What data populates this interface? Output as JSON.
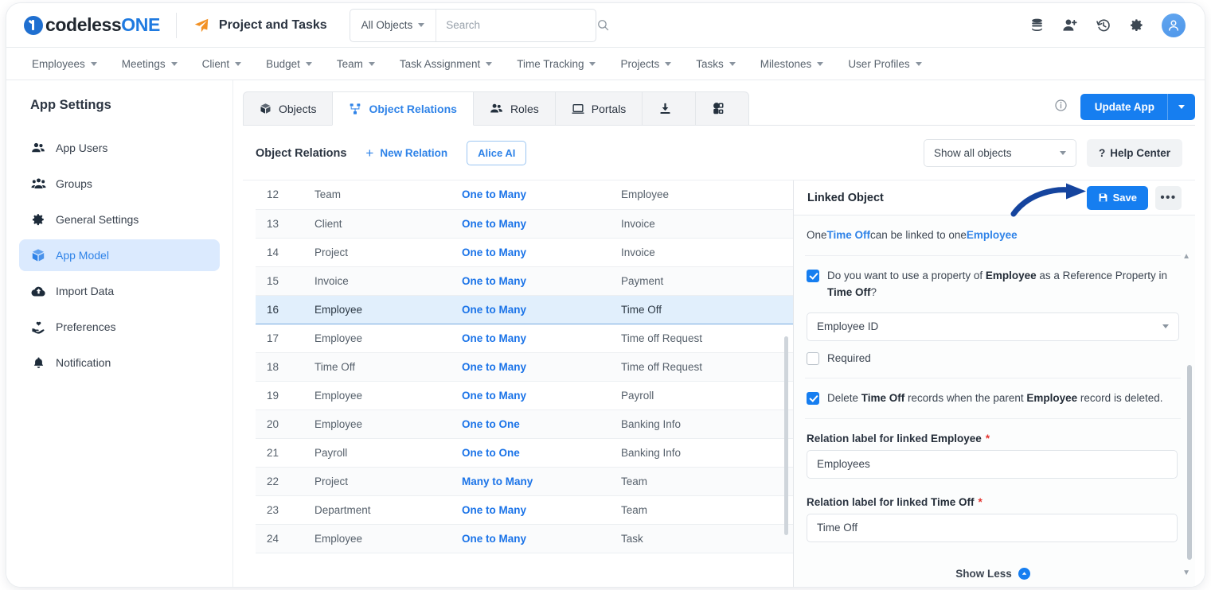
{
  "topbar": {
    "brand_codeless": "codeless",
    "brand_one": "ONE",
    "project_title": "Project and Tasks",
    "object_filter": "All Objects",
    "search_placeholder": "Search",
    "search_value": "",
    "icons": [
      "database-icon",
      "add-user-icon",
      "history-icon",
      "gear-icon",
      "avatar-icon"
    ]
  },
  "menubar": {
    "items": [
      {
        "label": "Employees"
      },
      {
        "label": "Meetings"
      },
      {
        "label": "Client"
      },
      {
        "label": "Budget"
      },
      {
        "label": "Team"
      },
      {
        "label": "Task Assignment"
      },
      {
        "label": "Time Tracking"
      },
      {
        "label": "Projects"
      },
      {
        "label": "Tasks"
      },
      {
        "label": "Milestones"
      },
      {
        "label": "User Profiles"
      }
    ]
  },
  "sidebar": {
    "title": "App Settings",
    "items": [
      {
        "label": "App Users",
        "icon": "users-icon",
        "active": false
      },
      {
        "label": "Groups",
        "icon": "group-icon",
        "active": false
      },
      {
        "label": "General Settings",
        "icon": "gear-icon",
        "active": false
      },
      {
        "label": "App Model",
        "icon": "cube-icon",
        "active": true
      },
      {
        "label": "Import Data",
        "icon": "cloud-upload-icon",
        "active": false
      },
      {
        "label": "Preferences",
        "icon": "hand-heart-icon",
        "active": false
      },
      {
        "label": "Notification",
        "icon": "bell-icon",
        "active": false
      }
    ]
  },
  "tabs": [
    {
      "label": "Objects",
      "icon": "cube-icon",
      "active": false
    },
    {
      "label": "Object Relations",
      "icon": "relations-icon",
      "active": true
    },
    {
      "label": "Roles",
      "icon": "users-icon",
      "active": false
    },
    {
      "label": "Portals",
      "icon": "portal-icon",
      "active": false
    },
    {
      "label": "",
      "icon": "download-icon",
      "active": false
    },
    {
      "label": "",
      "icon": "shapes-icon",
      "active": false
    }
  ],
  "header_actions": {
    "info_icon": "info-icon",
    "update_label": "Update App"
  },
  "toolbar": {
    "title": "Object Relations",
    "new_relation_label": "New Relation",
    "new_relation_plus": "+",
    "alice_label": "Alice AI",
    "show_objects_value": "Show all objects",
    "help_label": "Help Center",
    "help_mark": "?"
  },
  "table": {
    "rows": [
      {
        "id": "12",
        "from": "Team",
        "relation": "One to Many",
        "to": "Employee",
        "selected": false
      },
      {
        "id": "13",
        "from": "Client",
        "relation": "One to Many",
        "to": "Invoice",
        "selected": false
      },
      {
        "id": "14",
        "from": "Project",
        "relation": "One to Many",
        "to": "Invoice",
        "selected": false
      },
      {
        "id": "15",
        "from": "Invoice",
        "relation": "One to Many",
        "to": "Payment",
        "selected": false
      },
      {
        "id": "16",
        "from": "Employee",
        "relation": "One to Many",
        "to": "Time Off",
        "selected": true
      },
      {
        "id": "17",
        "from": "Employee",
        "relation": "One to Many",
        "to": "Time off Request",
        "selected": false
      },
      {
        "id": "18",
        "from": "Time Off",
        "relation": "One to Many",
        "to": "Time off Request",
        "selected": false
      },
      {
        "id": "19",
        "from": "Employee",
        "relation": "One to Many",
        "to": "Payroll",
        "selected": false
      },
      {
        "id": "20",
        "from": "Employee",
        "relation": "One to One",
        "to": "Banking Info",
        "selected": false
      },
      {
        "id": "21",
        "from": "Payroll",
        "relation": "One to One",
        "to": "Banking Info",
        "selected": false
      },
      {
        "id": "22",
        "from": "Project",
        "relation": "Many to Many",
        "to": "Team",
        "selected": false
      },
      {
        "id": "23",
        "from": "Department",
        "relation": "One to Many",
        "to": "Team",
        "selected": false
      },
      {
        "id": "24",
        "from": "Employee",
        "relation": "One to Many",
        "to": "Task",
        "selected": false
      }
    ]
  },
  "panel": {
    "title": "Linked Object",
    "save_label": "Save",
    "more_label": "•••",
    "summary": {
      "prefix": "One ",
      "object_a": "Time Off",
      "middle": " can be linked to one ",
      "object_b": "Employee"
    },
    "reference_property": {
      "checked": true,
      "text_1": "Do you want to use a property of ",
      "bold_1": "Employee",
      "text_2": " as a Reference Property in ",
      "bold_2": "Time Off",
      "text_3": "?",
      "select_value": "Employee ID",
      "required_label": "Required",
      "required_checked": false
    },
    "cascade_delete": {
      "checked": true,
      "text_1": "Delete ",
      "bold_1": "Time Off",
      "text_2": " records when the parent ",
      "bold_2": "Employee",
      "text_3": " record is deleted."
    },
    "relation_label_employee": {
      "label_prefix": "Relation label for linked ",
      "label_bold": "Employee",
      "required_mark": "*",
      "value": "Employees"
    },
    "relation_label_timeoff": {
      "label_prefix": "Relation label for linked ",
      "label_bold": "Time Off",
      "required_mark": "*",
      "value": "Time Off"
    },
    "show_less_label": "Show Less"
  },
  "colors": {
    "accent": "#167ef0",
    "link": "#1a73e8",
    "selected_row": "#e1effc",
    "sidebar_active": "#dbeafe",
    "required": "#e4342f"
  }
}
